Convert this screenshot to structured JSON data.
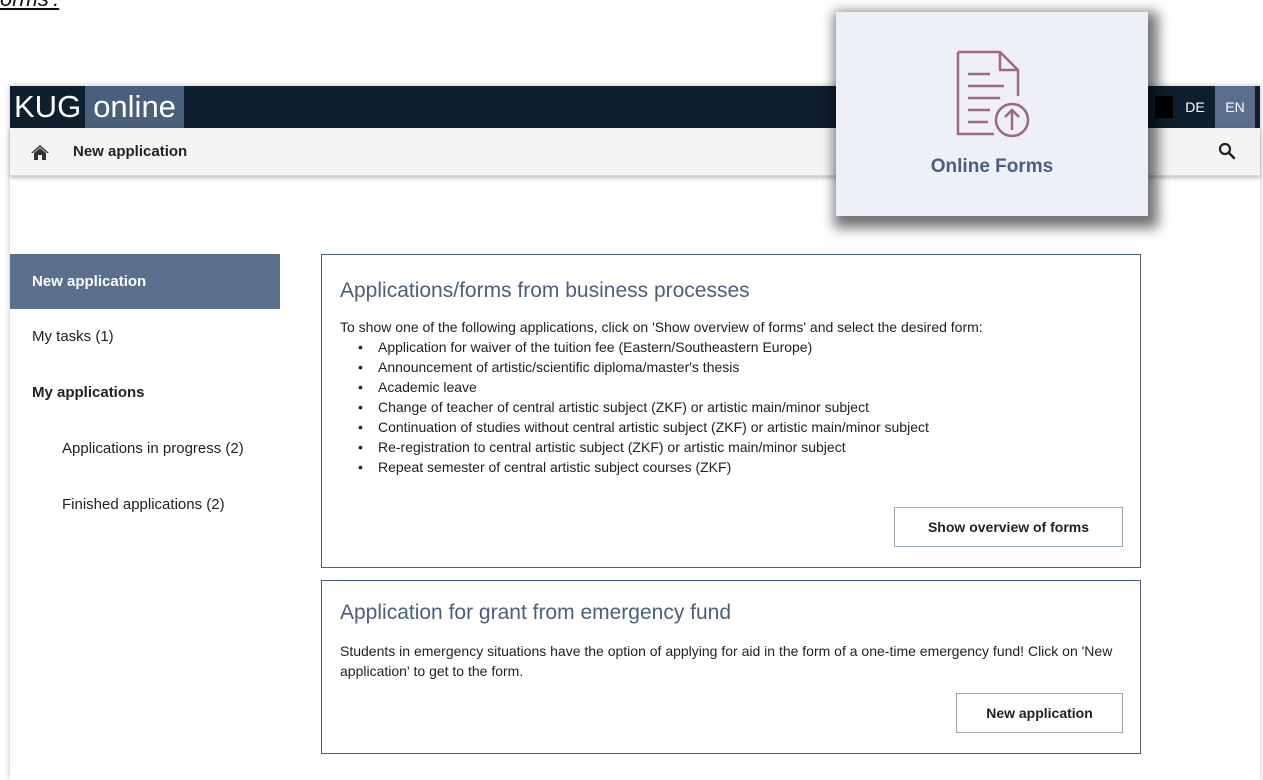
{
  "doc_fragment": "orms'.",
  "header": {
    "logo_primary": "KUG",
    "logo_secondary": "online",
    "languages": [
      "DE",
      "EN"
    ],
    "active_language": "EN"
  },
  "subbar": {
    "title": "New application"
  },
  "sidebar": {
    "items": [
      {
        "label": "New application",
        "active": true
      },
      {
        "label": "My tasks (1)"
      },
      {
        "label": "My applications"
      },
      {
        "label": "Applications in progress (2)"
      },
      {
        "label": "Finished applications (2)"
      }
    ]
  },
  "panels": [
    {
      "title": "Applications/forms from business processes",
      "description": "To show one of the following applications, click on 'Show overview of forms' and select the desired form:",
      "list": [
        "Application for waiver of the tuition fee (Eastern/Southeastern Europe)",
        "Announcement of artistic/scientific diploma/master's thesis",
        "Academic leave",
        "Change of teacher of central artistic subject (ZKF) or artistic main/minor subject",
        "Continuation of studies without central artistic subject (ZKF) or artistic main/minor subject",
        "Re-registration to central artistic subject (ZKF) or artistic main/minor subject",
        "Repeat semester of central artistic subject courses (ZKF)"
      ],
      "button": "Show overview of forms"
    },
    {
      "title": "Application for grant from emergency fund",
      "description": "Students in emergency situations have the option of applying for aid in the form of a one-time emergency fund! Click on 'New application' to get to the form.",
      "button": "New application"
    }
  ],
  "callout": {
    "label": "Online Forms",
    "icon": "document-upload-icon"
  },
  "colors": {
    "topbar": "#0f1f2e",
    "accent": "#5b6f8c",
    "panel_border": "#4a5f7c",
    "icon_stroke": "#a06878"
  }
}
